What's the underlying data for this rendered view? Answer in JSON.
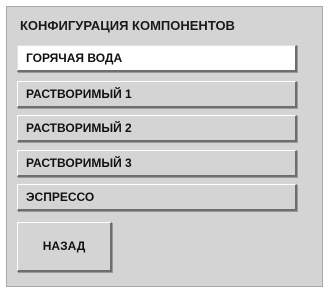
{
  "panel": {
    "title": "КОНФИГУРАЦИЯ КОМПОНЕНТОВ"
  },
  "menu": {
    "items": [
      {
        "label": "ГОРЯЧАЯ ВОДА",
        "selected": true
      },
      {
        "label": "РАСТВОРИМЫЙ 1",
        "selected": false
      },
      {
        "label": "РАСТВОРИМЫЙ 2",
        "selected": false
      },
      {
        "label": "РАСТВОРИМЫЙ 3",
        "selected": false
      },
      {
        "label": "ЭСПРЕССО",
        "selected": false
      }
    ]
  },
  "back_button": {
    "label": "НАЗАД"
  },
  "colors": {
    "panel_background": "#d4d4d4",
    "selected_item_background": "#ffffff",
    "text": "#111111"
  }
}
